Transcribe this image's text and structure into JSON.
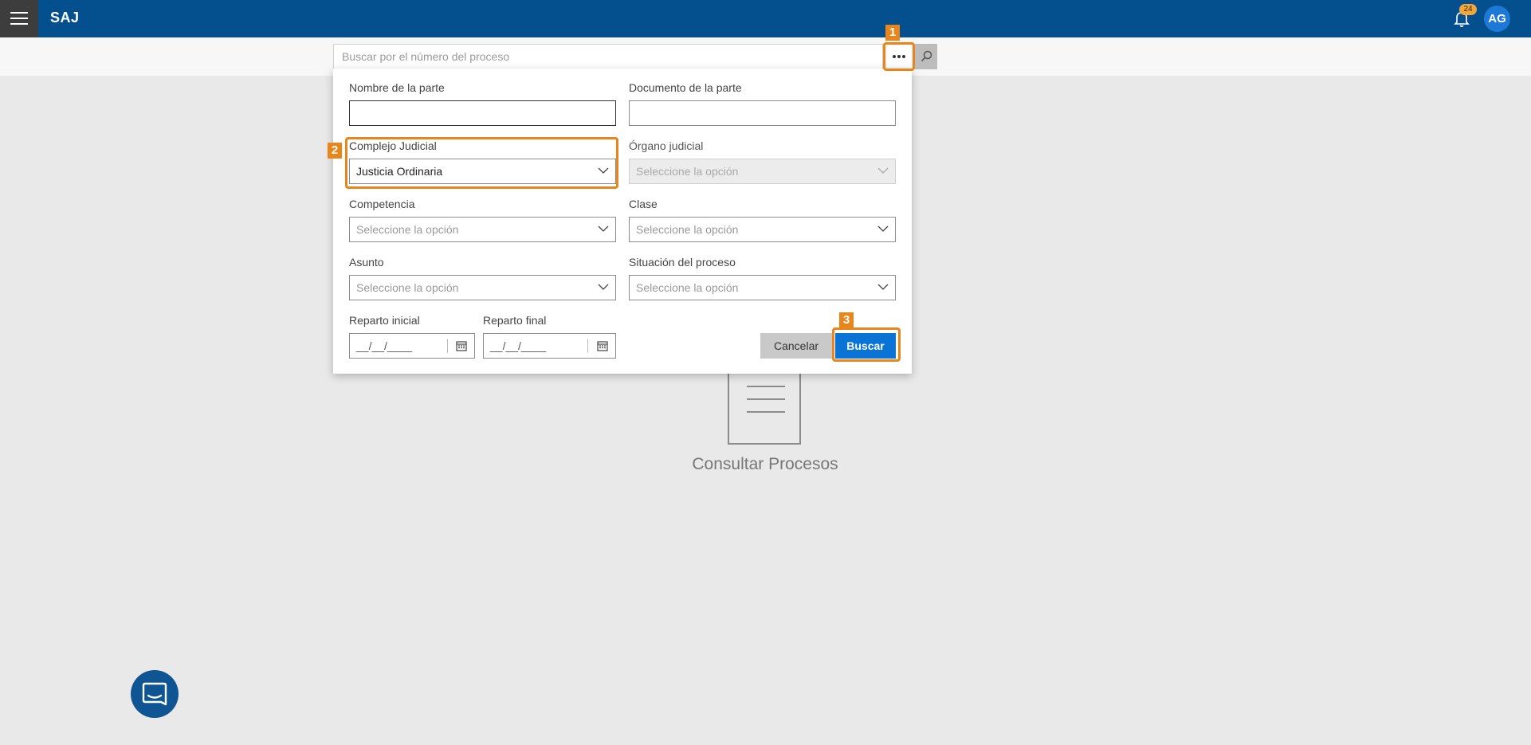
{
  "header": {
    "app_name": "SAJ",
    "menu_icon": "hamburger-icon",
    "notifications_count": "24",
    "avatar_initials": "AG",
    "bar_color": "#04508e"
  },
  "search": {
    "placeholder": "Buscar por el número del proceso",
    "more_icon": "ellipsis-icon",
    "search_icon": "magnifier-icon"
  },
  "advanced_search": {
    "nombre_parte": {
      "label": "Nombre de la parte",
      "value": ""
    },
    "documento_parte": {
      "label": "Documento de la parte",
      "value": ""
    },
    "complejo_judicial": {
      "label": "Complejo Judicial",
      "value": "Justicia Ordinaria"
    },
    "organo_judicial": {
      "label": "Órgano judicial",
      "placeholder": "Seleccione la opción"
    },
    "competencia": {
      "label": "Competencia",
      "placeholder": "Seleccione la opción"
    },
    "clase": {
      "label": "Clase",
      "placeholder": "Seleccione la opción"
    },
    "asunto": {
      "label": "Asunto",
      "placeholder": "Seleccione la opción"
    },
    "situacion": {
      "label": "Situación del proceso",
      "placeholder": "Seleccione la opción"
    },
    "reparto_inicial": {
      "label": "Reparto inicial",
      "mask": "__/__/____"
    },
    "reparto_final": {
      "label": "Reparto final",
      "mask": "__/__/____"
    },
    "cancel_label": "Cancelar",
    "search_label": "Buscar"
  },
  "annotations": {
    "step1": "1",
    "step2": "2",
    "step3": "3",
    "color": "#e8851b"
  },
  "empty_state": {
    "title": "Consultar Procesos",
    "icon": "document-icon"
  },
  "chat": {
    "icon": "chat-icon"
  }
}
